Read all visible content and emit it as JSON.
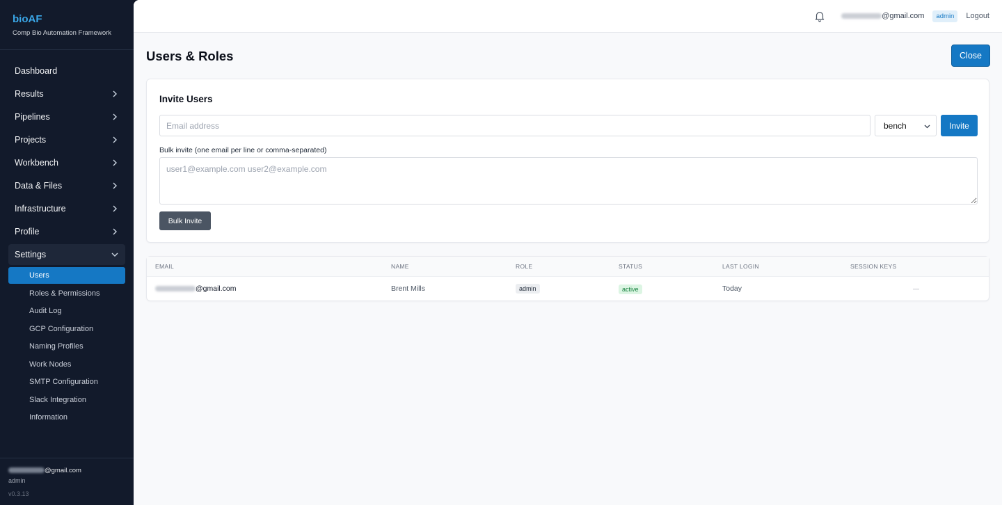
{
  "app": {
    "title": "bioAF",
    "subtitle": "Comp Bio Automation Framework"
  },
  "sidebar": {
    "items": [
      {
        "label": "Dashboard",
        "chevron": false
      },
      {
        "label": "Results",
        "chevron": true
      },
      {
        "label": "Pipelines",
        "chevron": true
      },
      {
        "label": "Projects",
        "chevron": true
      },
      {
        "label": "Workbench",
        "chevron": true
      },
      {
        "label": "Data & Files",
        "chevron": true
      },
      {
        "label": "Infrastructure",
        "chevron": true
      },
      {
        "label": "Profile",
        "chevron": true
      },
      {
        "label": "Settings",
        "chevron": true,
        "expanded": true
      }
    ],
    "settings_sub": [
      {
        "label": "Users",
        "active": true
      },
      {
        "label": "Roles & Permissions"
      },
      {
        "label": "Audit Log"
      },
      {
        "label": "GCP Configuration"
      },
      {
        "label": "Naming Profiles"
      },
      {
        "label": "Work Nodes"
      },
      {
        "label": "SMTP Configuration"
      },
      {
        "label": "Slack Integration"
      },
      {
        "label": "Information"
      }
    ],
    "footer": {
      "email_domain": "@gmail.com",
      "role": "admin",
      "version": "v0.3.13"
    }
  },
  "topbar": {
    "bell_icon": "bell-icon",
    "email_domain": "@gmail.com",
    "role_badge": "admin",
    "logout_label": "Logout"
  },
  "page": {
    "title": "Users & Roles",
    "close_label": "Close"
  },
  "invite": {
    "title": "Invite Users",
    "email_placeholder": "Email address",
    "role_selected": "bench",
    "invite_label": "Invite",
    "bulk_label": "Bulk invite (one email per line or comma-separated)",
    "bulk_placeholder": "user1@example.com user2@example.com",
    "bulk_button": "Bulk Invite"
  },
  "table": {
    "headers": [
      "EMAIL",
      "NAME",
      "ROLE",
      "STATUS",
      "LAST LOGIN",
      "SESSION KEYS"
    ],
    "rows": [
      {
        "email_domain": "@gmail.com",
        "name": "Brent Mills",
        "role": "admin",
        "status": "active",
        "last_login": "Today",
        "session_keys": "—"
      }
    ]
  },
  "colors": {
    "accent": "#1578c4",
    "sidebar_bg": "#121a2b",
    "brand": "#3aa7e8",
    "status_active": "#15803d"
  }
}
